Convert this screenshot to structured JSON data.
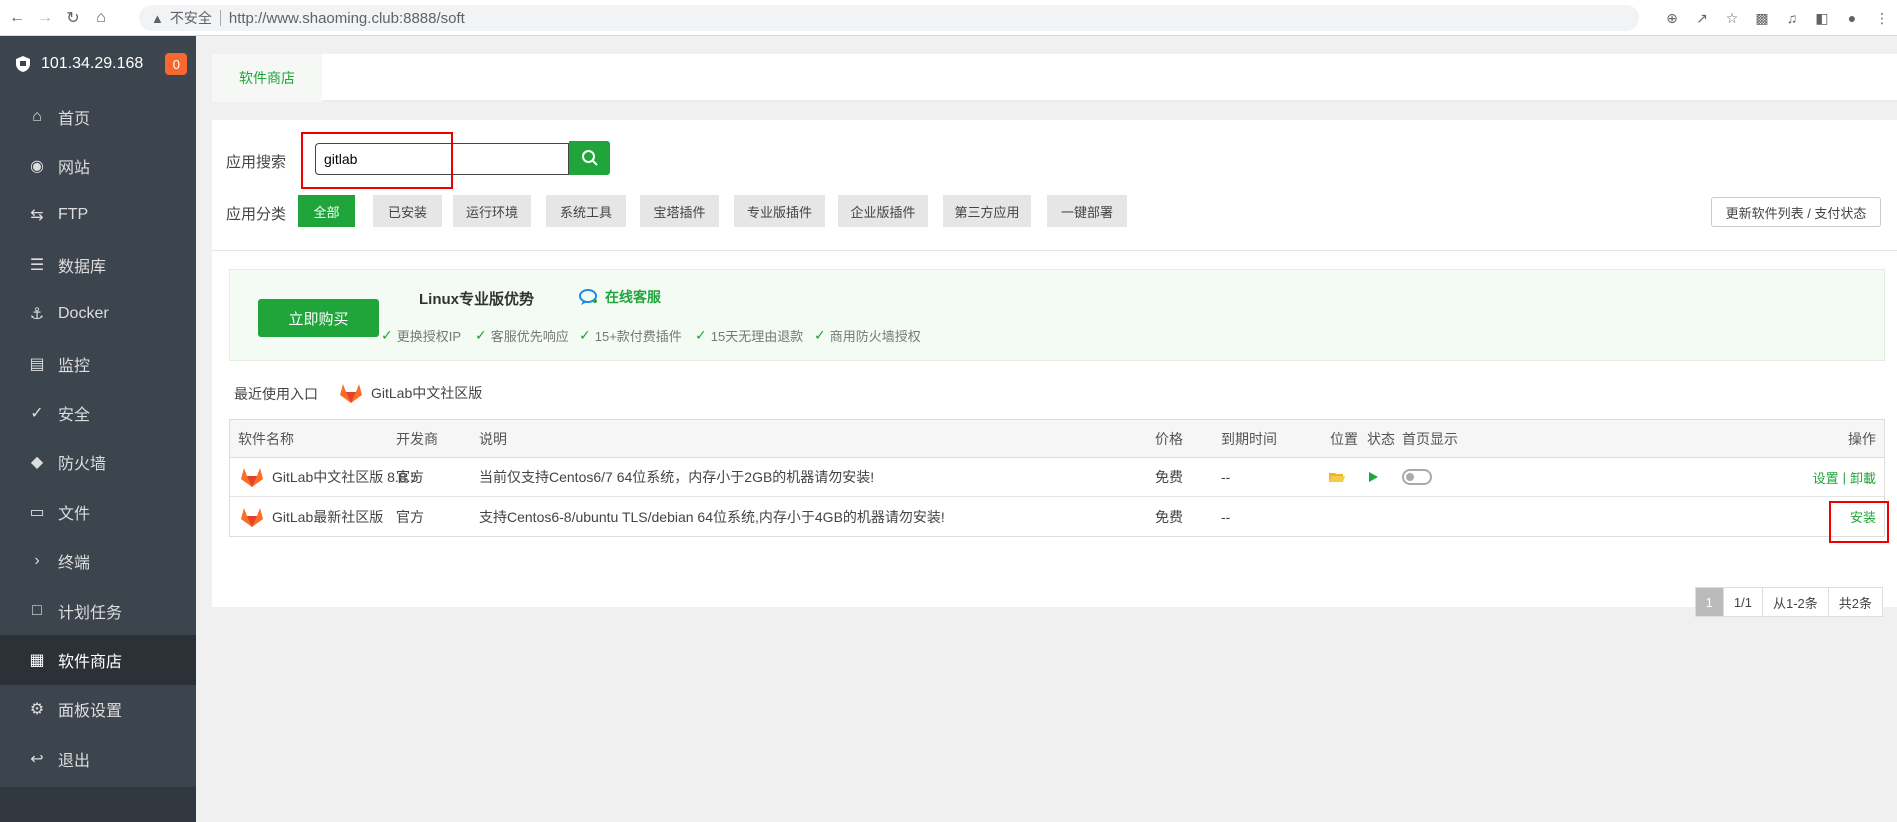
{
  "browser": {
    "insecure_label": "不安全",
    "url": "http://www.shaoming.club:8888/soft"
  },
  "sidebar": {
    "server_ip": "101.34.29.168",
    "badge": "0",
    "items": [
      {
        "label": "首页",
        "icon": "home-icon"
      },
      {
        "label": "网站",
        "icon": "globe-icon"
      },
      {
        "label": "FTP",
        "icon": "ftp-icon"
      },
      {
        "label": "数据库",
        "icon": "database-icon"
      },
      {
        "label": "Docker",
        "icon": "docker-icon"
      },
      {
        "label": "监控",
        "icon": "monitor-icon"
      },
      {
        "label": "安全",
        "icon": "shield-check-icon"
      },
      {
        "label": "防火墙",
        "icon": "firewall-shield-icon"
      },
      {
        "label": "文件",
        "icon": "folder-icon"
      },
      {
        "label": "终端",
        "icon": "terminal-icon"
      },
      {
        "label": "计划任务",
        "icon": "calendar-icon"
      },
      {
        "label": "软件商店",
        "icon": "grid-icon"
      },
      {
        "label": "面板设置",
        "icon": "gear-icon"
      },
      {
        "label": "退出",
        "icon": "logout-icon"
      }
    ],
    "active_index": 11
  },
  "tabs": {
    "store": "软件商店"
  },
  "search": {
    "label": "应用搜索",
    "value": "gitlab"
  },
  "categories": {
    "label": "应用分类",
    "items": [
      "全部",
      "已安装",
      "运行环境",
      "系统工具",
      "宝塔插件",
      "专业版插件",
      "企业版插件",
      "第三方应用",
      "一键部署"
    ],
    "refresh": "更新软件列表 / 支付状态"
  },
  "promo": {
    "buy": "立即购买",
    "title": "Linux专业版优势",
    "online": "在线客服",
    "features": [
      "更换授权IP",
      "客服优先响应",
      "15+款付费插件",
      "15天无理由退款",
      "商用防火墙授权"
    ]
  },
  "recent": {
    "label": "最近使用入口",
    "app": "GitLab中文社区版"
  },
  "table": {
    "headers": {
      "name": "软件名称",
      "dev": "开发商",
      "desc": "说明",
      "price": "价格",
      "expire": "到期时间",
      "location": "位置",
      "status": "状态",
      "home": "首页显示",
      "ops": "操作"
    },
    "rows": [
      {
        "name": "GitLab中文社区版 8.8.5",
        "dev": "官方",
        "desc": "当前仅支持Centos6/7 64位系统，内存小于2GB的机器请勿安装!",
        "price": "免费",
        "expire": "--",
        "op_settings": "设置",
        "op_sep": "|",
        "op_uninstall": "卸載"
      },
      {
        "name": "GitLab最新社区版",
        "dev": "官方",
        "desc": "支持Centos6-8/ubuntu TLS/debian 64位系统,内存小于4GB的机器请勿安装!",
        "price": "免费",
        "expire": "--",
        "op_install": "安装"
      }
    ]
  },
  "pager": {
    "current": "1",
    "pages": "1/1",
    "range": "从1-2条",
    "total": "共2条"
  },
  "colors": {
    "brand_green": "#20a53a",
    "sidebar_bg": "#3c444d",
    "badge": "#f7672e",
    "highlight_red": "#e00000"
  }
}
